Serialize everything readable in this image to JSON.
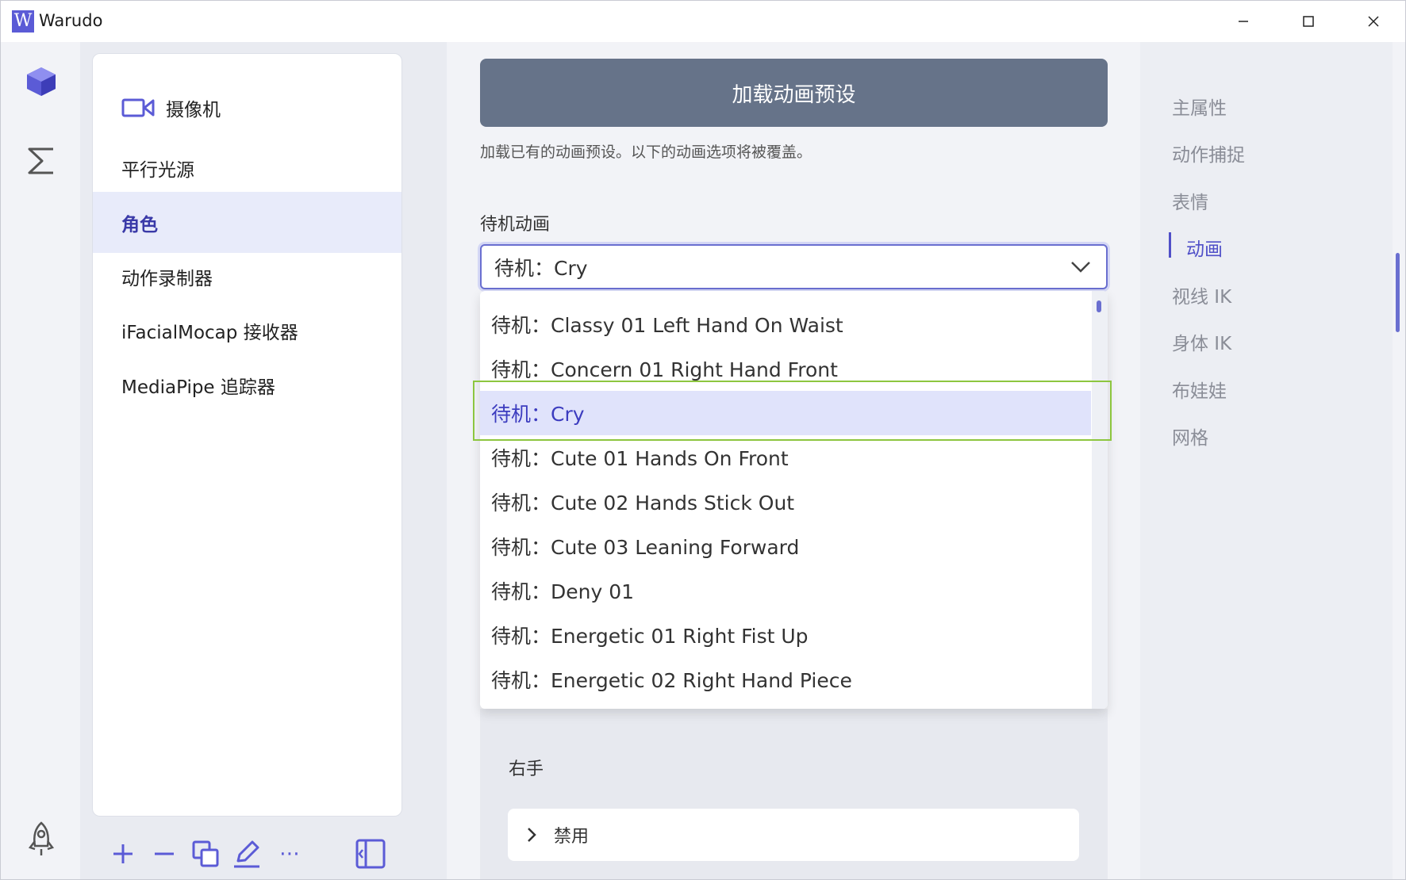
{
  "window": {
    "title": "Warudo",
    "logo_letter": "W"
  },
  "rail": {
    "icons": [
      "cube-icon",
      "sigma-icon",
      "rocket-icon"
    ]
  },
  "scene_list": {
    "items": [
      {
        "label": "摄像机",
        "icon": "video-camera-icon"
      },
      {
        "label": "平行光源"
      },
      {
        "label": "角色",
        "active": true
      },
      {
        "label": "动作录制器"
      },
      {
        "label": "iFacialMocap 接收器"
      },
      {
        "label": "MediaPipe 追踪器"
      }
    ],
    "toolbar": [
      "plus-icon",
      "minus-icon",
      "duplicate-icon",
      "rename-icon",
      "more-icon",
      "collapse-panel-icon"
    ],
    "more_label": "⋯"
  },
  "main": {
    "load_button": "加载动画预设",
    "load_description": "加载已有的动画预设。以下的动画选项将被覆盖。",
    "idle_label": "待机动画",
    "idle_selected": "待机：Cry",
    "dropdown_options": [
      "待机：Classy 01 Left Hand On Waist",
      "待机：Concern 01 Right Hand Front",
      "待机：Cry",
      "待机：Cute 01 Hands On Front",
      "待机：Cute 02 Hands Stick Out",
      "待机：Cute 03 Leaning Forward",
      "待机：Deny 01",
      "待机：Energetic 01 Right Fist Up",
      "待机：Energetic 02 Right Hand Piece"
    ],
    "selected_option_index": 2,
    "right_hand_label": "右手",
    "right_hand_value": "禁用"
  },
  "right_nav": {
    "items": [
      "主属性",
      "动作捕捉",
      "表情",
      "动画",
      "视线 IK",
      "身体 IK",
      "布娃娃",
      "网格"
    ],
    "active": "动画"
  },
  "colors": {
    "accent": "#5050c8",
    "load_button_bg": "#667389",
    "selection_bg": "#e0e3fb",
    "highlight_border": "#8dc63f"
  }
}
